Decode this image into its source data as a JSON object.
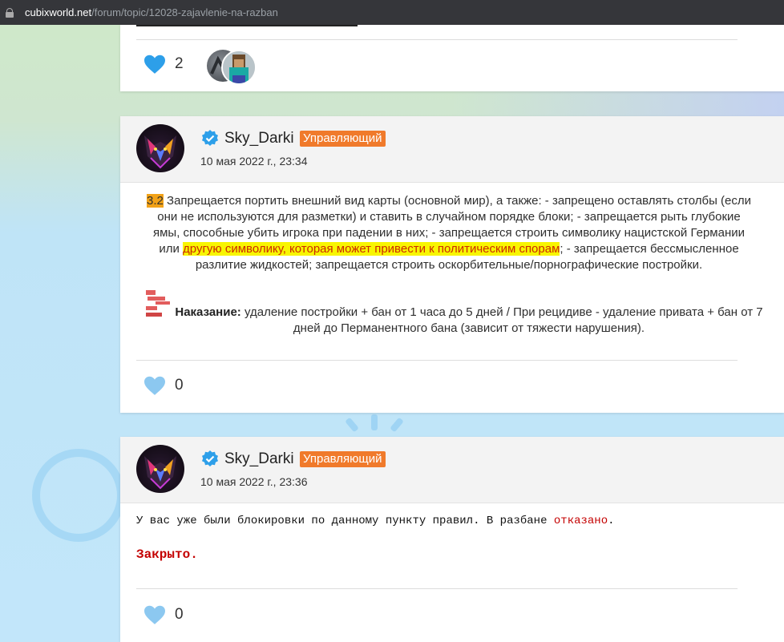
{
  "browser": {
    "url_host": "cubixworld.net",
    "url_path": "/forum/topic/12028-zajavlenie-na-razban"
  },
  "colors": {
    "accent_heart": "#2d9fe9",
    "heart_light": "#8cc8f0",
    "badge": "#f07a2b",
    "highlight_number": "#f2a218",
    "highlight_yellow": "#f8f500",
    "denied_red": "#c40000"
  },
  "previous_post": {
    "likes": "2",
    "like_icon": "heart-icon"
  },
  "post_rule": {
    "author": "Sky_Darki",
    "role": "Управляющий",
    "date": "10 мая 2022 г., 23:34",
    "rule_number": "3.2",
    "rule_text_1": " Запрещается портить внешний вид карты (основной мир), а также: - запрещено оставлять столбы (если они не используются для разметки) и ставить в случайном порядке блоки; - запрещается рыть глубокие ямы, способные убить игрока при падении в них; - запрещается строить символику нацистской Германии или ",
    "rule_text_highlight": "другую символику, которая может привести к политическим спорам",
    "rule_text_2": "; - запрещается бессмысленное разлитие жидкостей; запрещается строить оскорбительные/порнографические постройки.",
    "punishment_label": "Наказание:",
    "punishment_text": " удаление постройки + бан от 1 часа до 5 дней / При рецидиве - удаление привата + бан от 7 дней до Перманентного бана (зависит от тяжести нарушения).",
    "likes": "0"
  },
  "post_reply": {
    "author": "Sky_Darki",
    "role": "Управляющий",
    "date": "10 мая 2022 г., 23:36",
    "reply_text": "У вас уже были блокировки по данному пункту правил. В разбане ",
    "reply_denied": "отказано",
    "reply_end": ".",
    "closed": "Закрыто.",
    "likes": "0"
  }
}
